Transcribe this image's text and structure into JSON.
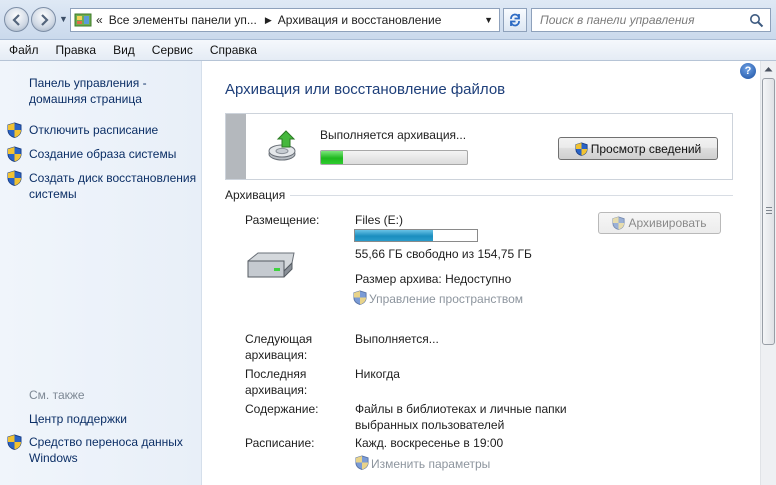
{
  "address_bar": {
    "chevrons": "«",
    "crumb_1": "Все элементы панели уп...",
    "crumb_2": "Архивация и восстановление",
    "search_placeholder": "Поиск в панели управления"
  },
  "menu": [
    "Файл",
    "Правка",
    "Вид",
    "Сервис",
    "Справка"
  ],
  "left_pane": {
    "home_link_line1": "Панель управления -",
    "home_link_line2": "домашняя страница",
    "tasks": [
      {
        "label": "Отключить расписание"
      },
      {
        "label": "Создание образа системы"
      },
      {
        "label_line1": "Создать диск восстановления",
        "label_line2": "системы"
      }
    ],
    "see_also": "См. также",
    "support_center": "Центр поддержки",
    "transfer_line1": "Средство переноса данных",
    "transfer_line2": "Windows"
  },
  "main": {
    "title": "Архивация или восстановление файлов",
    "status": {
      "text": "Выполняется архивация...",
      "progress": 0.15,
      "details_button": "Просмотр сведений"
    },
    "section_title": "Архивация",
    "location_label": "Размещение:",
    "location_value": "Files (E:)",
    "drive_used_fraction": 0.64,
    "free_space": "55,66 ГБ свободно из 154,75 ГБ",
    "archive_size": "Размер архива: Недоступно",
    "manage_space_link": "Управление пространством",
    "backup_button": "Архивировать",
    "next_label_line1": "Следующая",
    "next_label_line2": "архивация:",
    "next_value": "Выполняется...",
    "last_label_line1": "Последняя",
    "last_label_line2": "архивация:",
    "last_value": "Никогда",
    "contents_label": "Содержание:",
    "contents_value_line1": "Файлы в библиотеках и личные папки",
    "contents_value_line2": "выбранных пользователей",
    "schedule_label": "Расписание:",
    "schedule_value": "Кажд. воскресенье в 19:00",
    "change_settings_link": "Изменить параметры"
  },
  "colors": {
    "link": "#0c2f66",
    "title": "#1e3f7a",
    "progress_green": "#1fb81f",
    "drive_blue": "#1b8ebf",
    "disabled_text": "#8d959e"
  }
}
